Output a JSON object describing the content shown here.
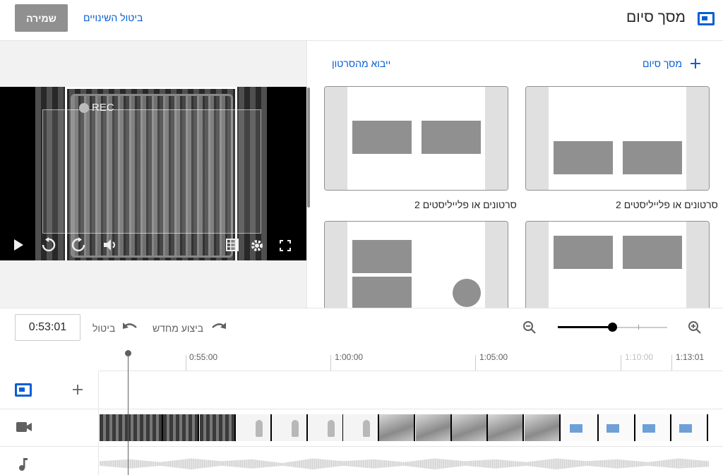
{
  "header": {
    "title": "מסך סיום",
    "save_label": "שמירה",
    "discard_label": "ביטול השינויים"
  },
  "preview": {
    "overlay_text": "REC"
  },
  "templates_panel": {
    "add_endscreen_label": "מסך סיום",
    "import_label": "ייבוא מהסרטון",
    "templates": [
      {
        "label": "2 סרטונים או פלייליסטים"
      },
      {
        "label": "2 סרטונים או פלייליסטים"
      },
      {
        "label": ""
      },
      {
        "label": ""
      }
    ]
  },
  "timeline_toolbar": {
    "current_time": "0:53:01",
    "undo_label": "ביטול",
    "redo_label": "ביצוע מחדש"
  },
  "ruler": {
    "labels": [
      "0:55:00",
      "1:00:00",
      "1:05:00",
      "1:10:00",
      "1:13:01"
    ]
  },
  "icons": {
    "endscreen": "endscreen-icon",
    "add": "plus-icon",
    "video_track": "videocam-icon",
    "audio_track": "music-note-icon"
  },
  "colors": {
    "accent": "#065fd4",
    "save_disabled": "#909090"
  }
}
